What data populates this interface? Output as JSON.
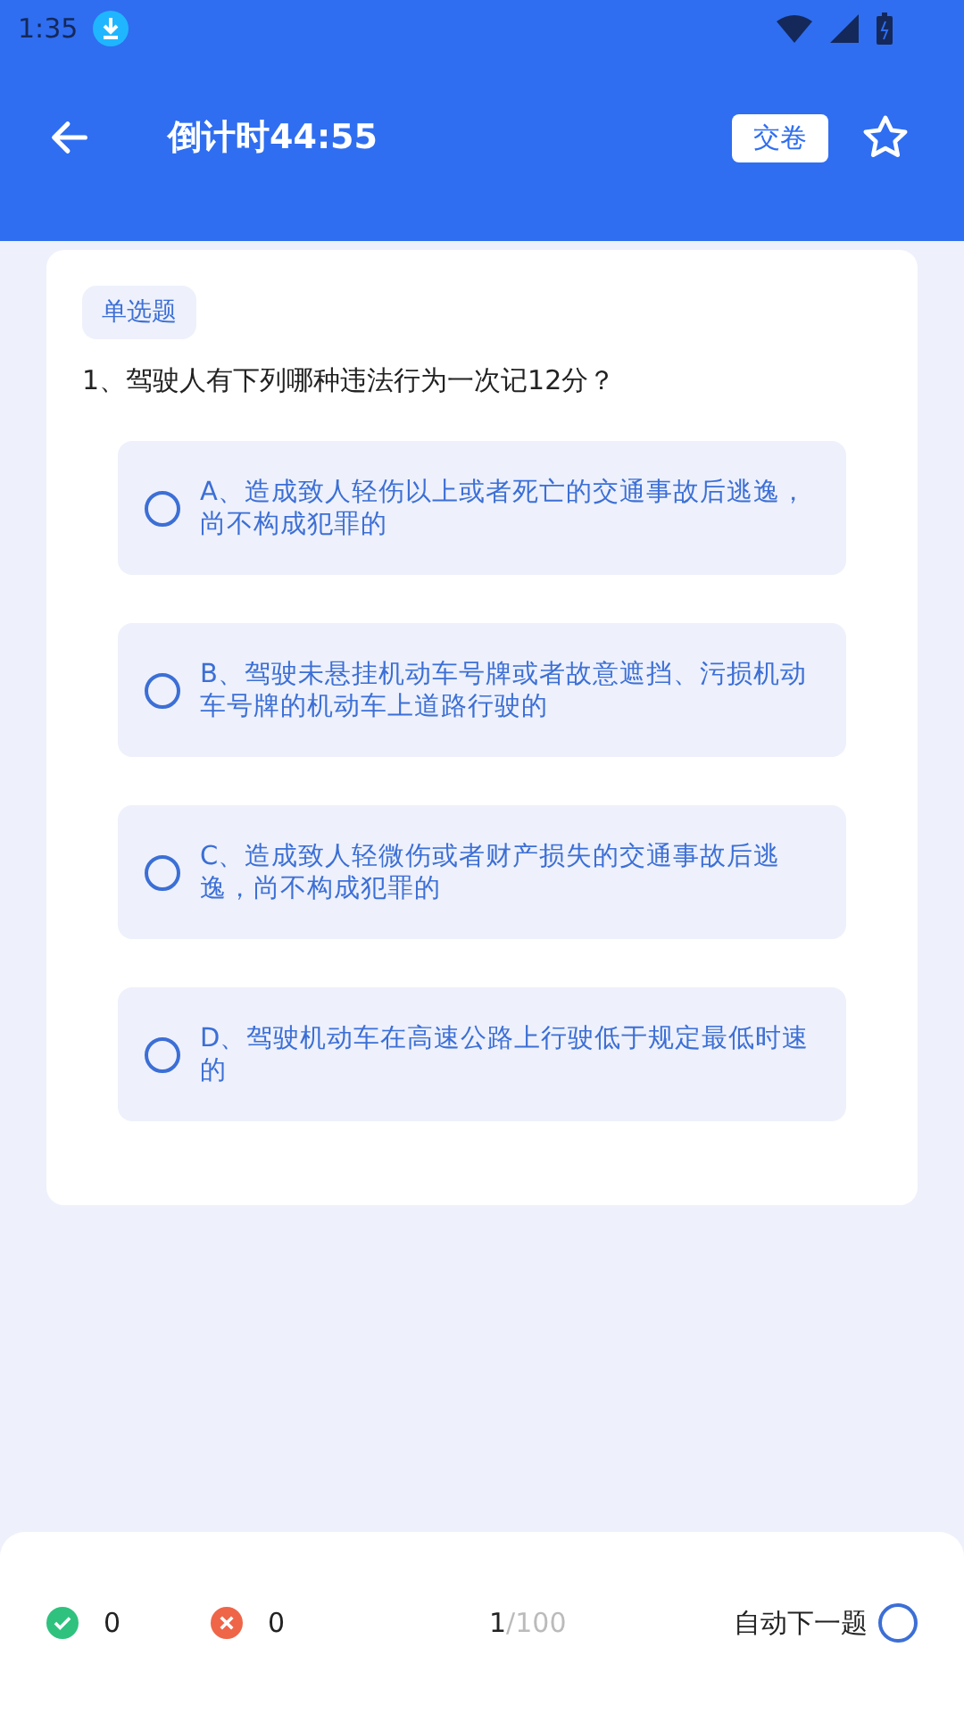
{
  "status_bar": {
    "time": "1:35"
  },
  "header": {
    "title": "倒计时44:55",
    "submit_button": "交卷",
    "favorite": {
      "selected": false
    }
  },
  "question": {
    "type_tag": "单选题",
    "text": "1、驾驶人有下列哪种违法行为一次记12分？",
    "options": [
      {
        "text": "A、造成致人轻伤以上或者死亡的交通事故后逃逸，尚不构成犯罪的",
        "selected": false
      },
      {
        "text": "B、驾驶未悬挂机动车号牌或者故意遮挡、污损机动车号牌的机动车上道路行驶的",
        "selected": false
      },
      {
        "text": "C、造成致人轻微伤或者财产损失的交通事故后逃逸，尚不构成犯罪的",
        "selected": false
      },
      {
        "text": "D、驾驶机动车在高速公路上行驶低于规定最低时速的",
        "selected": false
      }
    ]
  },
  "footer": {
    "correct_count": "0",
    "wrong_count": "0",
    "current": "1",
    "total": "/100",
    "auto_next": {
      "label": "自动下一题",
      "on": false
    }
  }
}
